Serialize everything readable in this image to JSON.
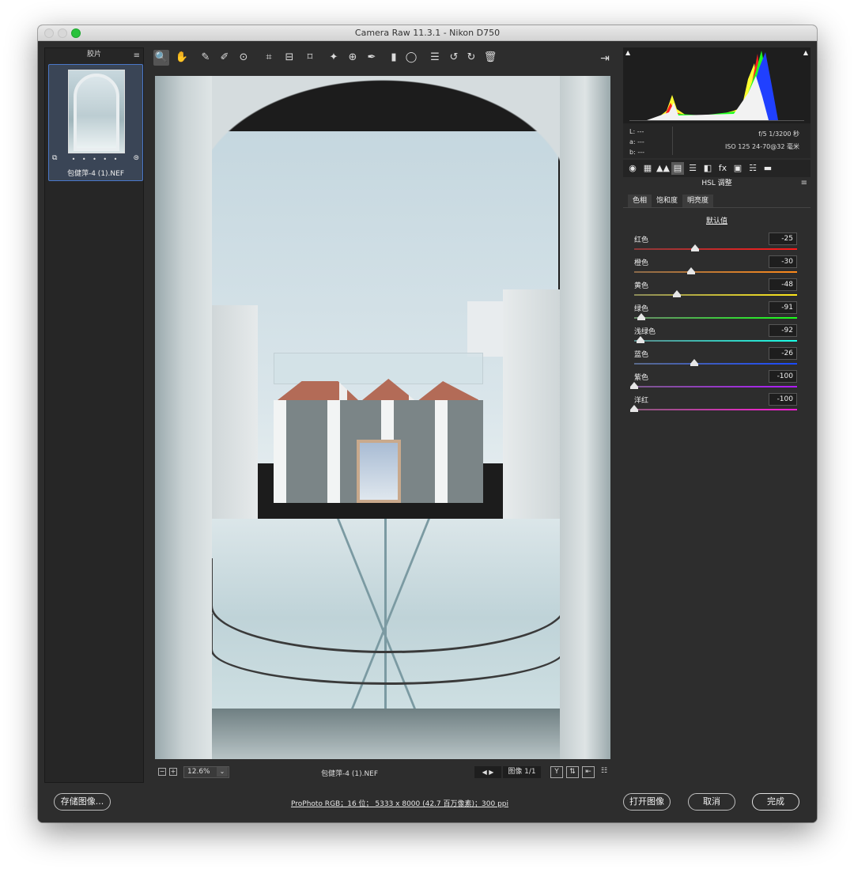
{
  "window": {
    "title": "Camera Raw 11.3.1 -  Nikon D750"
  },
  "filmstrip": {
    "title": "胶片",
    "thumb": {
      "filename": "包健萍-4 (1).NEF",
      "dots": "• • • • •"
    }
  },
  "toolbar": {
    "tools": [
      {
        "name": "zoom-tool",
        "glyph": "🔍"
      },
      {
        "name": "hand-tool",
        "glyph": "✋"
      },
      {
        "name": "white-balance-tool",
        "glyph": "✎"
      },
      {
        "name": "color-sampler-tool",
        "glyph": "✐"
      },
      {
        "name": "targeted-adjustment-tool",
        "glyph": "⊙"
      },
      {
        "name": "crop-tool",
        "glyph": "⌗"
      },
      {
        "name": "straighten-tool",
        "glyph": "⊟"
      },
      {
        "name": "transform-tool",
        "glyph": "⌑"
      },
      {
        "name": "spot-removal-tool",
        "glyph": "✦"
      },
      {
        "name": "red-eye-tool",
        "glyph": "⊕"
      },
      {
        "name": "adjustment-brush-tool",
        "glyph": "✒"
      },
      {
        "name": "graduated-filter-tool",
        "glyph": "▮"
      },
      {
        "name": "radial-filter-tool",
        "glyph": "◯"
      },
      {
        "name": "preferences-tool",
        "glyph": "☰"
      },
      {
        "name": "rotate-left-tool",
        "glyph": "↺"
      },
      {
        "name": "rotate-right-tool",
        "glyph": "↻"
      },
      {
        "name": "trash-tool",
        "glyph": "🗑"
      }
    ],
    "exit_glyph": "⇥"
  },
  "statusbar": {
    "zoom_out": "−",
    "zoom_in": "+",
    "zoom": "12.6%",
    "zoom_arrow": "⌄",
    "filename": "包健萍-4 (1).NEF",
    "nav": "◀ ▶",
    "counter": "图像 1/1",
    "icon_y": "Y",
    "icon_swap": "⇅",
    "icon_copy": "⇤",
    "icon_settings": "☷"
  },
  "histogram": {
    "colors": {
      "red": "#ff2020",
      "green": "#20ff20",
      "blue": "#2040ff",
      "yellow": "#ffff30",
      "white": "#f2f2f2"
    },
    "shadow_warning": "▲",
    "highlight_warning": "▲"
  },
  "camera_info": {
    "l": "L:   ---",
    "a": "a:   ---",
    "b": "b:   ---",
    "aperture_shutter": "f/5   1/3200 秒",
    "iso_lens": "ISO 125   24-70@32 毫米"
  },
  "panel": {
    "tabs": [
      "◉",
      "▦",
      "▲▲",
      "▤",
      "☰",
      "◧",
      "fx",
      "▣",
      "☵",
      "▬"
    ],
    "active_tab": 3,
    "title": "HSL 调整",
    "menu": "≡",
    "subtabs": [
      "色相",
      "饱和度",
      "明亮度"
    ],
    "active_subtab": 1,
    "default_link": "默认值"
  },
  "sliders": [
    {
      "label": "红色",
      "value": "-25",
      "fraction": 0.375,
      "track": "linear-gradient(90deg,#8a3a3a,#ff1a1a)"
    },
    {
      "label": "橙色",
      "value": "-30",
      "fraction": 0.35,
      "track": "linear-gradient(90deg,#8a6a4a,#ff8a1a)"
    },
    {
      "label": "黄色",
      "value": "-48",
      "fraction": 0.26,
      "track": "linear-gradient(90deg,#8a8a5a,#ffe81a)"
    },
    {
      "label": "绿色",
      "value": "-91",
      "fraction": 0.045,
      "track": "linear-gradient(90deg,#6a8a6a,#1aff1a)"
    },
    {
      "label": "浅绿色",
      "value": "-92",
      "fraction": 0.04,
      "track": "linear-gradient(90deg,#5a8a8a,#1affe8)"
    },
    {
      "label": "蓝色",
      "value": "-26",
      "fraction": 0.37,
      "track": "linear-gradient(90deg,#5a6a8a,#1a4aff)"
    },
    {
      "label": "紫色",
      "value": "-100",
      "fraction": 0.0,
      "track": "linear-gradient(90deg,#7a5a8a,#b01aff)"
    },
    {
      "label": "洋红",
      "value": "-100",
      "fraction": 0.0,
      "track": "linear-gradient(90deg,#8a5a7a,#ff1ad8)"
    }
  ],
  "bottom": {
    "save": "存储图像...",
    "file_info": "ProPhoto RGB；16 位；  5333 x 8000 (42.7 百万像素)；300 ppi",
    "open": "打开图像",
    "cancel": "取消",
    "done": "完成"
  }
}
